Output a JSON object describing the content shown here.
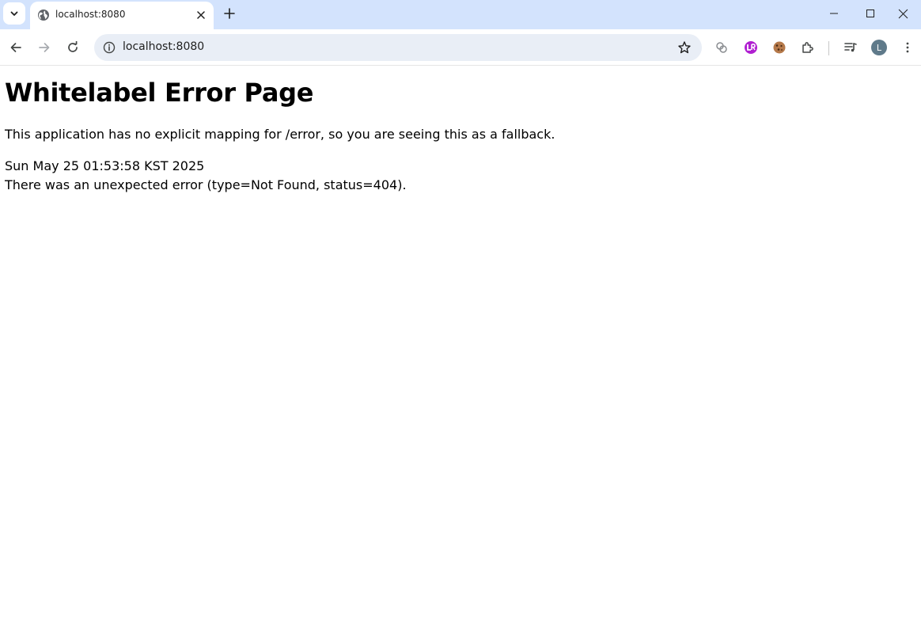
{
  "browser": {
    "tab": {
      "title": "localhost:8080"
    },
    "omnibox": {
      "url": "localhost:8080"
    },
    "profile": {
      "initial": "L"
    },
    "colors": {
      "tabstrip": "#d3e3fd",
      "omnibox": "#e9eef6",
      "icon": "#444746"
    }
  },
  "page": {
    "heading": "Whitelabel Error Page",
    "message": "This application has no explicit mapping for /error, so you are seeing this as a fallback.",
    "timestamp": "Sun May 25 01:53:58 KST 2025",
    "error": "There was an unexpected error (type=Not Found, status=404)."
  }
}
